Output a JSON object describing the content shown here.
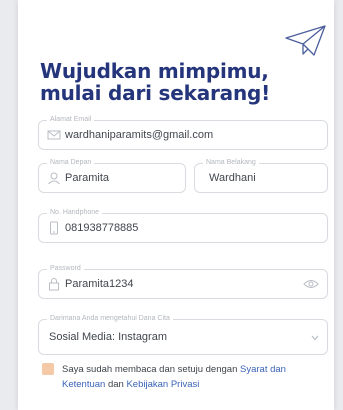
{
  "form": {
    "headline_line1": "Wujudkan mimpimu,",
    "headline_line2": "mulai dari sekarang!",
    "email": {
      "label": "Alamat Email",
      "value": "wardhaniparamits@gmail.com",
      "icon": "envelope-icon"
    },
    "first_name": {
      "label": "Nama Depan",
      "value": "Paramita",
      "icon": "user-icon"
    },
    "last_name": {
      "label": "Nama Belakang",
      "value": "Wardhani"
    },
    "phone": {
      "label": "No. Handphone",
      "value": "081938778885",
      "icon": "phone-icon"
    },
    "password": {
      "label": "Password",
      "value": "Paramita1234",
      "icon": "lock-icon"
    },
    "source": {
      "label": "Darimana Anda mengetahui Dana Cita",
      "value": "Sosial Media: Instagram"
    },
    "agree": {
      "prefix": "Saya sudah membaca dan setuju dengan ",
      "link1": "Syarat dan Ketentuan",
      "middle": " dan ",
      "link2": "Kebijakan Privasi"
    }
  },
  "colors": {
    "headline": "#24357c",
    "link": "#3a63b8",
    "checkbox": "#f3c9a7"
  }
}
